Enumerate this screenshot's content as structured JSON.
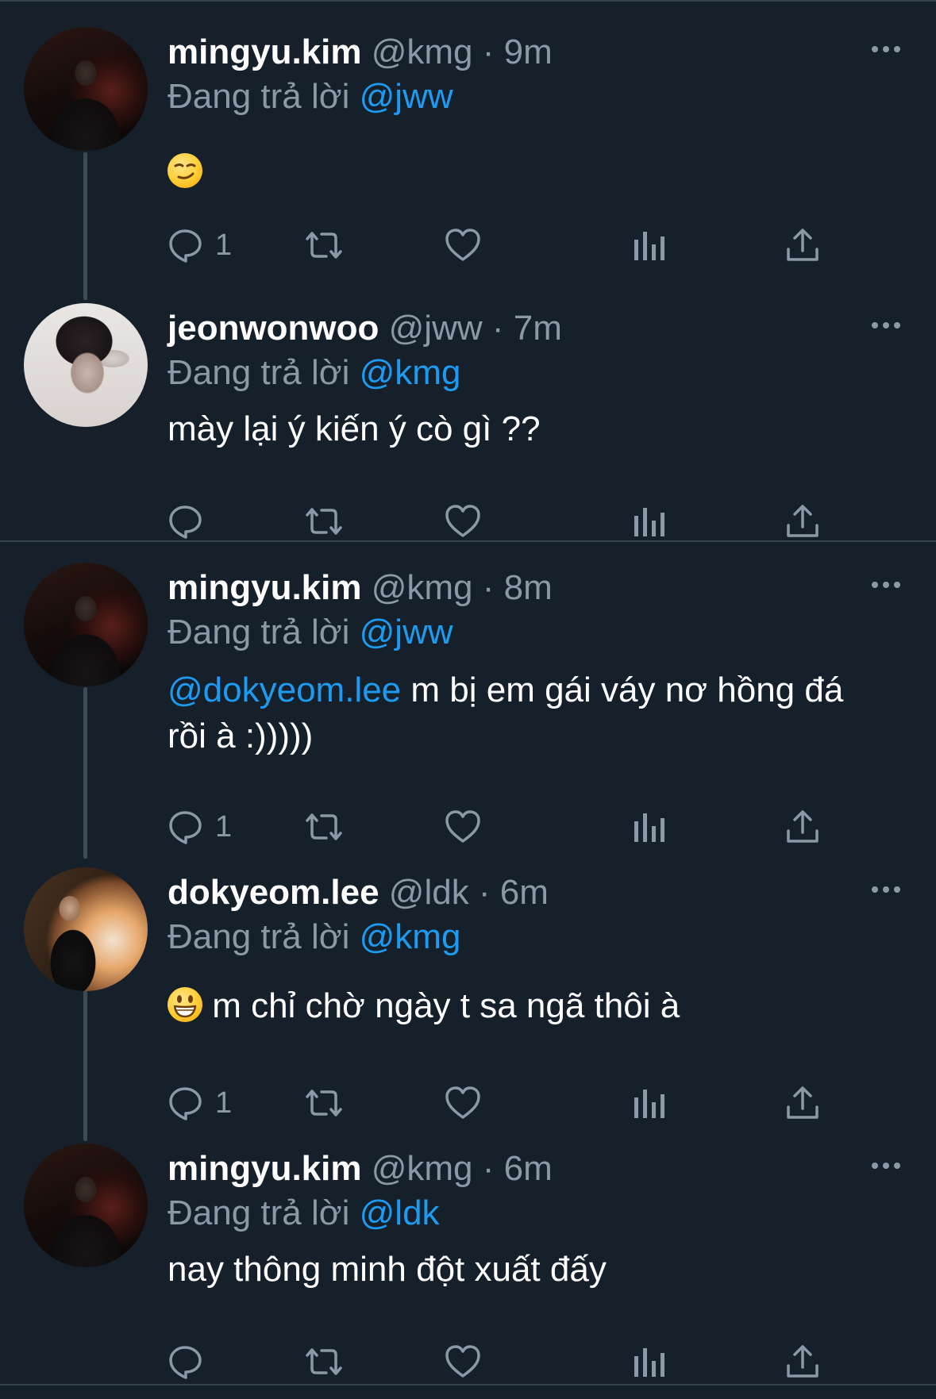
{
  "theme": {
    "background": "#15202b",
    "text": "#ffffff",
    "muted": "#8b98a5",
    "link": "#1d9bf0",
    "divider": "#38444d"
  },
  "tweets": [
    {
      "display_name": "mingyu.kim",
      "handle_time": "@kmg · 9m",
      "reply_prefix": "Đang trả lời",
      "reply_to": "@jww",
      "emoji_icon": "smirking-face-emoji",
      "text": "",
      "reply_count": "1"
    },
    {
      "display_name": "jeonwonwoo",
      "handle_time": "@jww · 7m",
      "reply_prefix": "Đang trả lời",
      "reply_to": "@kmg",
      "text": "mày lại ý kiến ý cò gì ??",
      "reply_count": ""
    },
    {
      "display_name": "mingyu.kim",
      "handle_time": "@kmg · 8m",
      "reply_prefix": "Đang trả lời",
      "reply_to": "@jww",
      "mention": "@dokyeom.lee",
      "text": " m bị em gái váy nơ hồng đá rồi à :)))))",
      "reply_count": "1"
    },
    {
      "display_name": "dokyeom.lee",
      "handle_time": "@ldk · 6m",
      "reply_prefix": "Đang trả lời",
      "reply_to": "@kmg",
      "emoji_icon": "grinning-face-emoji",
      "text": " m chỉ chờ ngày t sa ngã thôi à",
      "reply_count": "1"
    },
    {
      "display_name": "mingyu.kim",
      "handle_time": "@kmg · 6m",
      "reply_prefix": "Đang trả lời",
      "reply_to": "@ldk",
      "text": "nay thông minh đột xuất đấy",
      "reply_count": ""
    }
  ],
  "icons": {
    "reply": "reply-icon",
    "retweet": "retweet-icon",
    "like": "like-icon",
    "views": "views-icon",
    "share": "share-icon",
    "more": "more-icon"
  }
}
